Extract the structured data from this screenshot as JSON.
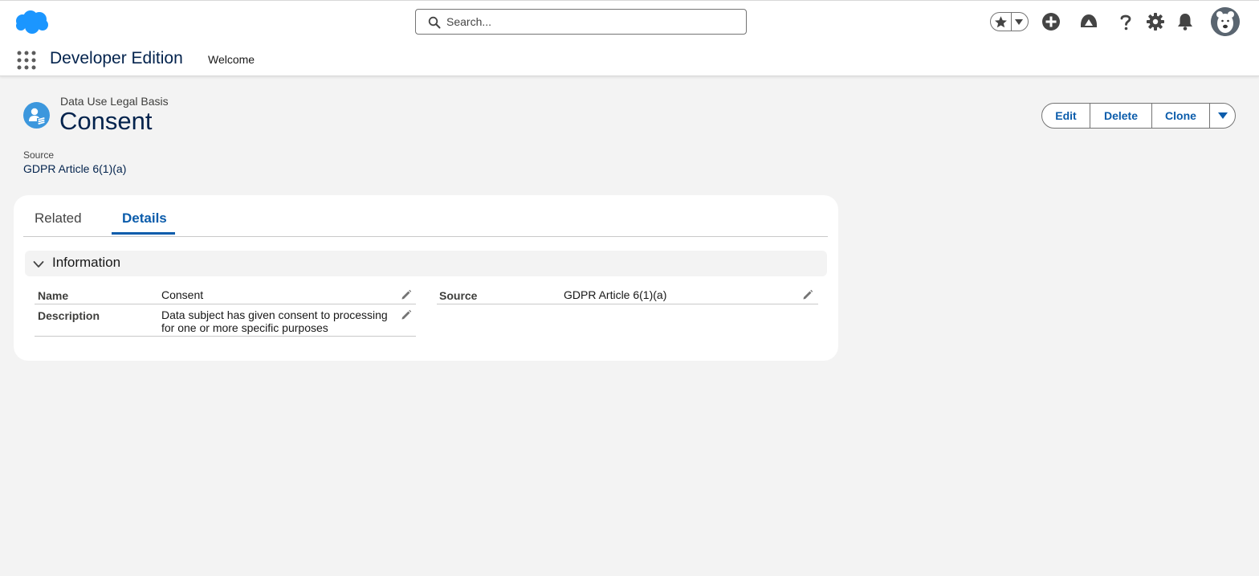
{
  "header": {
    "search": {
      "placeholder": "Search..."
    },
    "icons": [
      "salesforce-cloud-icon",
      "search-icon",
      "star-icon",
      "chevron-down-icon",
      "add-icon",
      "trailhead-icon",
      "help-icon",
      "setup-gear-icon",
      "notification-bell-icon",
      "avatar-icon"
    ]
  },
  "nav": {
    "app_name": "Developer Edition",
    "items": [
      {
        "label": "Welcome"
      }
    ]
  },
  "record": {
    "object_type": "Data Use Legal Basis",
    "title": "Consent",
    "actions": [
      {
        "label": "Edit"
      },
      {
        "label": "Delete"
      },
      {
        "label": "Clone"
      }
    ],
    "highlights": {
      "label": "Source",
      "value": "GDPR Article 6(1)(a)"
    }
  },
  "tabs": [
    {
      "label": "Related"
    },
    {
      "label": "Details"
    }
  ],
  "active_tab": "Details",
  "section": {
    "title": "Information",
    "fields": {
      "name": {
        "label": "Name",
        "value": "Consent"
      },
      "description": {
        "label": "Description",
        "value": "Data subject has given consent to processing for one or more specific purposes"
      },
      "source": {
        "label": "Source",
        "value": "GDPR Article 6(1)(a)"
      }
    }
  },
  "colors": {
    "brand_blue": "#0b5cab",
    "title_navy": "#03234d",
    "record_icon": "#3c97dd",
    "page_background": "#f3f3f3"
  }
}
